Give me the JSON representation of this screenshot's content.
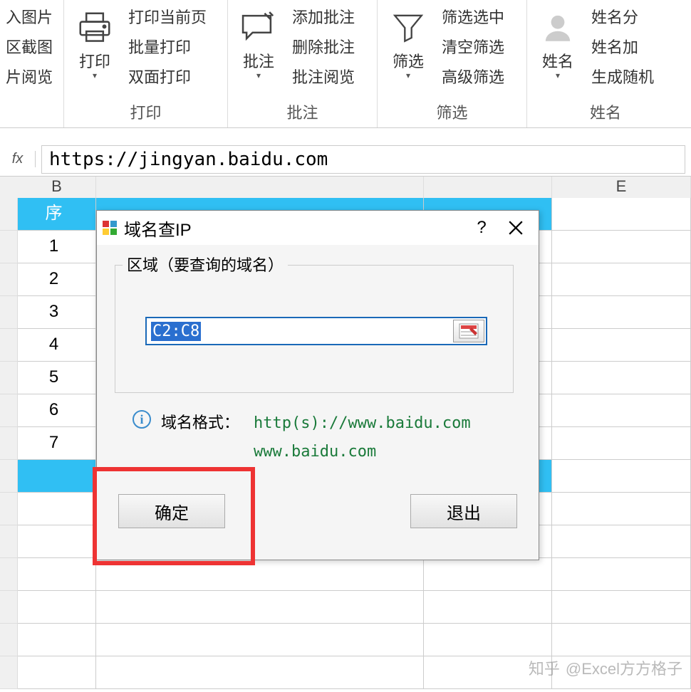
{
  "ribbon": {
    "groups": [
      {
        "label": "",
        "side_items": [
          "入图片",
          "区截图",
          "片阅览"
        ]
      },
      {
        "label": "打印",
        "button": "打印",
        "items": [
          "打印当前页",
          "批量打印",
          "双面打印"
        ]
      },
      {
        "label": "批注",
        "button": "批注",
        "items": [
          "添加批注",
          "删除批注",
          "批注阅览"
        ]
      },
      {
        "label": "筛选",
        "button": "筛选",
        "items": [
          "筛选选中",
          "清空筛选",
          "高级筛选"
        ]
      },
      {
        "label": "姓名",
        "button": "姓名",
        "items": [
          "姓名分",
          "姓名加",
          "生成随机"
        ]
      }
    ]
  },
  "formula_bar": {
    "fx": "fx",
    "value": "https://jingyan.baidu.com"
  },
  "columns": {
    "B": "B",
    "E": "E"
  },
  "table": {
    "header": "序",
    "rows": [
      "1",
      "2",
      "3",
      "4",
      "5",
      "6",
      "7"
    ]
  },
  "dialog": {
    "title": "域名查IP",
    "help": "?",
    "fieldset_label": "区域（要查询的域名）",
    "range_value": "C2:C8",
    "hint_label": "域名格式：",
    "hint_ex1": "http(s)://www.baidu.com",
    "hint_ex2": "www.baidu.com",
    "ok": "确定",
    "quit": "退出"
  },
  "watermark": {
    "brand": "知乎",
    "author": "@Excel方方格子"
  }
}
